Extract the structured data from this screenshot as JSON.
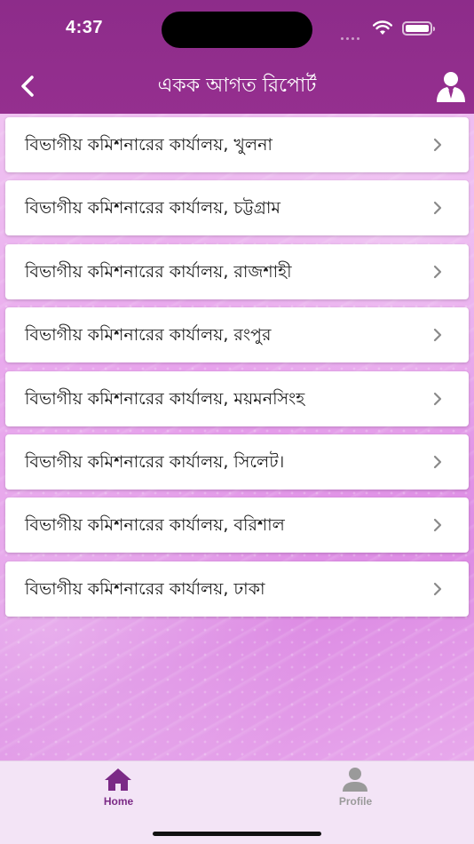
{
  "status_bar": {
    "time": "4:37"
  },
  "header": {
    "title": "একক আগত রিপোর্ট",
    "back_icon": "chevron-left-icon",
    "profile_icon": "user-tie-icon"
  },
  "offices": [
    {
      "label": "বিভাগীয় কমিশনারের কার্যালয়, খুলনা"
    },
    {
      "label": "বিভাগীয় কমিশনারের কার্যালয়, চট্টগ্রাম"
    },
    {
      "label": "বিভাগীয় কমিশনারের কার্যালয়, রাজশাহী"
    },
    {
      "label": "বিভাগীয় কমিশনারের কার্যালয়, রংপুর"
    },
    {
      "label": "বিভাগীয় কমিশনারের কার্যালয়, ময়মনসিংহ"
    },
    {
      "label": "বিভাগীয় কমিশনারের কার্যালয়, সিলেট।"
    },
    {
      "label": "বিভাগীয় কমিশনারের কার্যালয়, বরিশাল"
    },
    {
      "label": "বিভাগীয় কমিশনারের কার্যালয়, ঢাকা"
    }
  ],
  "tab_bar": {
    "tabs": [
      {
        "label": "Home",
        "icon": "home-icon",
        "active": true
      },
      {
        "label": "Profile",
        "icon": "person-icon",
        "active": false
      }
    ]
  },
  "colors": {
    "header": "#8d2c8a",
    "active_tab": "#7b2a86",
    "inactive_tab": "#9a9a9a",
    "tab_bar": "#f3e4f6"
  }
}
